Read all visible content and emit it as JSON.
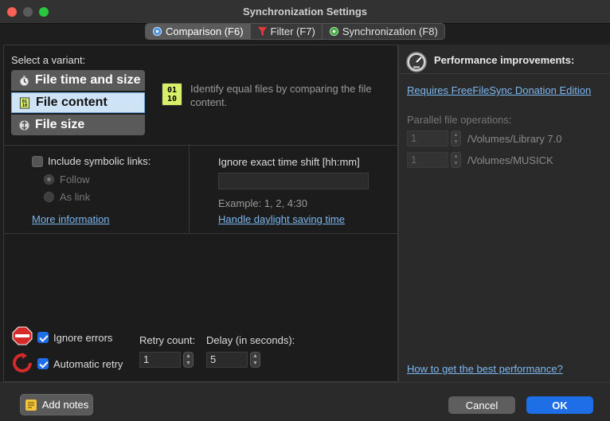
{
  "window": {
    "title": "Synchronization Settings"
  },
  "tabs": [
    {
      "label": "Comparison (F6)",
      "icon": "compare-gear-icon",
      "active": true
    },
    {
      "label": "Filter (F7)",
      "icon": "filter-funnel-icon",
      "active": false
    },
    {
      "label": "Synchronization (F8)",
      "icon": "sync-gear-icon",
      "active": false
    }
  ],
  "comparison": {
    "select_label": "Select a variant:",
    "variants": [
      {
        "label": "File time and size",
        "icon": "clock-icon",
        "selected": false
      },
      {
        "label": "File content",
        "icon": "binary-file-icon",
        "selected": true
      },
      {
        "label": "File size",
        "icon": "size-icon",
        "selected": false
      }
    ],
    "description_icon_text": [
      "01",
      "10"
    ],
    "description": "Identify equal files by comparing the file content."
  },
  "symlinks": {
    "checkbox_label": "Include symbolic links:",
    "checked": false,
    "options": [
      {
        "label": "Follow",
        "selected": true
      },
      {
        "label": "As link",
        "selected": false
      }
    ],
    "more_info": "More information"
  },
  "time_shift": {
    "label": "Ignore exact time shift [hh:mm]",
    "value": "",
    "example": "Example: 1, 2, 4:30",
    "daylight_link": "Handle daylight saving time"
  },
  "errors": {
    "ignore_errors_label": "Ignore errors",
    "ignore_errors_checked": true,
    "auto_retry_label": "Automatic retry",
    "auto_retry_checked": true,
    "retry_count_label": "Retry count:",
    "retry_count_value": "1",
    "delay_label": "Delay (in seconds):",
    "delay_value": "5"
  },
  "performance": {
    "title": "Performance improvements:",
    "donation_link": "Requires FreeFileSync Donation Edition",
    "parallel_label": "Parallel file operations:",
    "volumes": [
      {
        "value": "1",
        "path": "/Volumes/Library 7.0"
      },
      {
        "value": "1",
        "path": "/Volumes/MUSICK"
      }
    ],
    "best_perf_link": "How to get the best performance?"
  },
  "footer": {
    "add_notes": "Add notes",
    "cancel": "Cancel",
    "ok": "OK"
  },
  "colors": {
    "accent": "#1e6ee8",
    "link": "#7cb7f0",
    "selected_variant": "#cfe3f7"
  }
}
